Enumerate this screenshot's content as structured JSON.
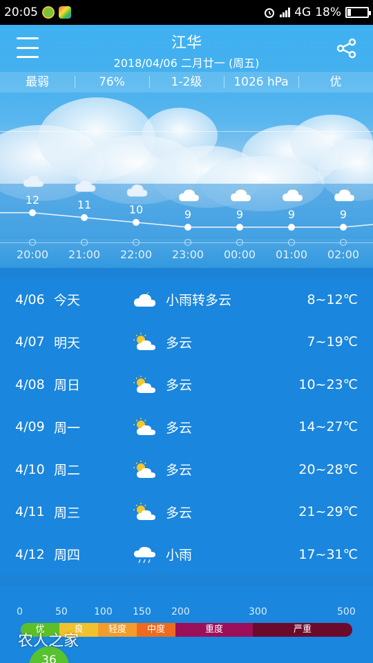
{
  "status_bar": {
    "time": "20:05",
    "network": "4G",
    "battery": "18%"
  },
  "header": {
    "city": "江华",
    "date_line": "2018/04/06 二月廿一 (周五)"
  },
  "info_strip": [
    "最弱",
    "76%",
    "1-2级",
    "1026 hPa",
    "优"
  ],
  "hourly": [
    {
      "time": "20:00",
      "temp": "12",
      "icon": "cloud-icon"
    },
    {
      "time": "21:00",
      "temp": "11",
      "icon": "cloud-icon"
    },
    {
      "time": "22:00",
      "temp": "10",
      "icon": "cloud-icon"
    },
    {
      "time": "23:00",
      "temp": "9",
      "icon": "cloud-moon-icon"
    },
    {
      "time": "00:00",
      "temp": "9",
      "icon": "cloud-moon-icon"
    },
    {
      "time": "01:00",
      "temp": "9",
      "icon": "cloud-moon-icon"
    },
    {
      "time": "02:00",
      "temp": "9",
      "icon": "cloud-moon-icon"
    }
  ],
  "daily": [
    {
      "date": "4/06",
      "day": "今天",
      "icon": "cloud-moon-icon",
      "desc": "小雨转多云",
      "range": "8~12℃"
    },
    {
      "date": "4/07",
      "day": "明天",
      "icon": "partly-cloudy-icon",
      "desc": "多云",
      "range": "7~19℃"
    },
    {
      "date": "4/08",
      "day": "周日",
      "icon": "partly-cloudy-icon",
      "desc": "多云",
      "range": "10~23℃"
    },
    {
      "date": "4/09",
      "day": "周一",
      "icon": "partly-cloudy-icon",
      "desc": "多云",
      "range": "14~27℃"
    },
    {
      "date": "4/10",
      "day": "周二",
      "icon": "partly-cloudy-icon",
      "desc": "多云",
      "range": "20~28℃"
    },
    {
      "date": "4/11",
      "day": "周三",
      "icon": "partly-cloudy-icon",
      "desc": "多云",
      "range": "21~29℃"
    },
    {
      "date": "4/12",
      "day": "周四",
      "icon": "light-rain-icon",
      "desc": "小雨",
      "range": "17~31℃"
    }
  ],
  "aqi": {
    "ticks": [
      "0",
      "50",
      "100",
      "150",
      "200",
      "300",
      "500"
    ],
    "levels": [
      {
        "label": "优",
        "color": "#5cbf2a"
      },
      {
        "label": "良",
        "color": "#f2c12e"
      },
      {
        "label": "轻度",
        "color": "#f29c2b"
      },
      {
        "label": "中度",
        "color": "#ee6a1e"
      },
      {
        "label": "重度",
        "color": "#9c0f5a"
      },
      {
        "label": "严重",
        "color": "#6c0a2c"
      }
    ],
    "current": "36",
    "watermark": "农人之家"
  },
  "colors": {
    "background": "#1d83d6",
    "daily_bg": "#1a86dd"
  }
}
